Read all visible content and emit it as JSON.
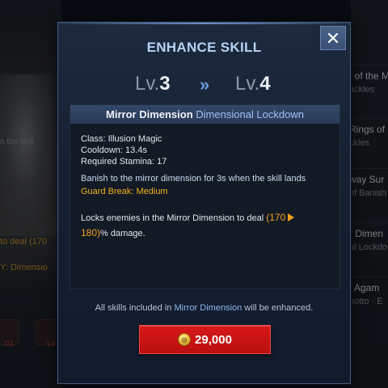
{
  "background": {
    "left_texts": [
      "n the skill",
      "to deal (170",
      "Y: Dimensio"
    ],
    "left_icon_labels": [
      "01",
      "Lv"
    ],
    "right_items": [
      {
        "line1": "f of the M",
        "line2": "ackles"
      },
      {
        "line1": "Rings of",
        "line2": "ckles"
      },
      {
        "line1": "way Sur",
        "line2": "of Banish"
      },
      {
        "line1": "r Dimen",
        "line2": "al Lockdo"
      },
      {
        "line1": "f Agam",
        "line2": "notto · E"
      }
    ]
  },
  "modal": {
    "title": "ENHANCE SKILL",
    "close_glyph": "✕"
  },
  "levels": {
    "prefix": "Lv.",
    "from": "3",
    "to": "4",
    "arrow": "»"
  },
  "skill": {
    "name": "Mirror Dimension",
    "option": "Dimensional Lockdown",
    "class_line": "Class: Illusion Magic",
    "cooldown_line": "Cooldown: 13.4s",
    "stamina_line": "Required Stamina: 17",
    "description": "Banish to the mirror dimension for 3s when the skill lands",
    "guard_break": "Guard Break: Medium",
    "effect_prefix": "Locks enemies in the Mirror Dimension to deal ",
    "effect_from": "(170",
    "effect_to": "180)",
    "effect_suffix": "% damage."
  },
  "footer": {
    "note_prefix": "All skills included in ",
    "note_highlight": "Mirror Dimension",
    "note_suffix": " will be enhanced."
  },
  "cost": {
    "amount": "29,000",
    "currency_icon": "gold-coin-icon",
    "button_color": "#c81414"
  },
  "colors": {
    "title": "#b7d1f5",
    "accent_blue": "#9cc1f2",
    "guard_break": "#f0b21c",
    "damage_value": "#f4a21c"
  }
}
